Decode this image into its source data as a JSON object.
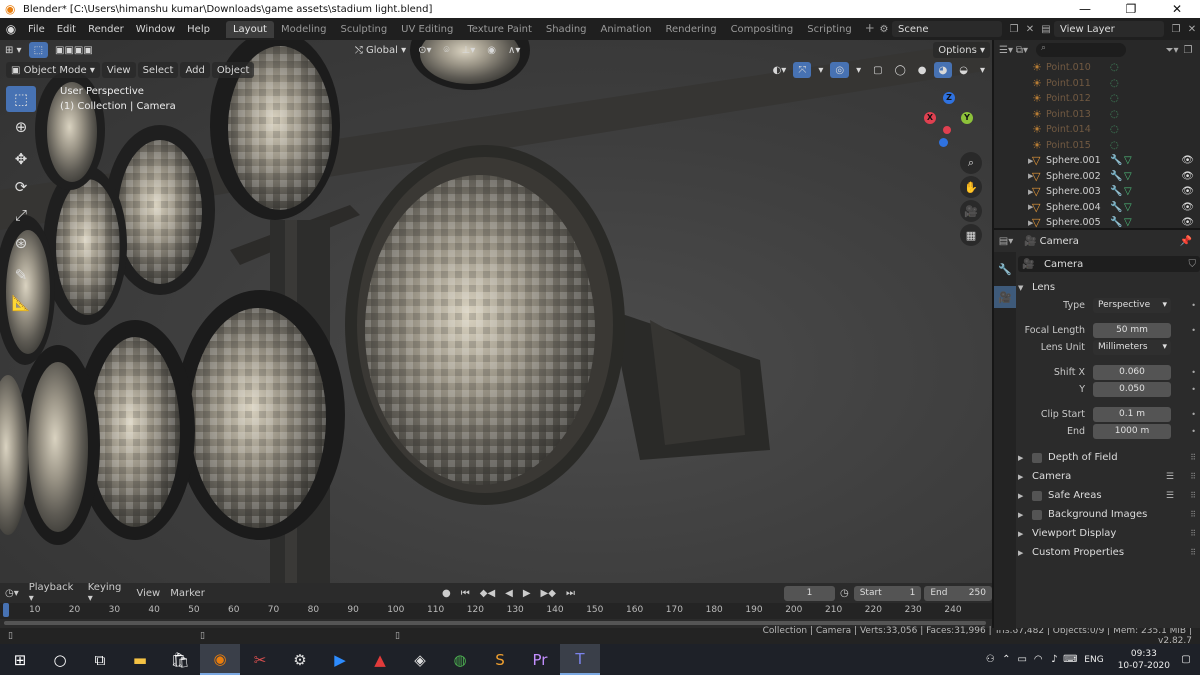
{
  "window": {
    "title": "Blender* [C:\\Users\\himanshu kumar\\Downloads\\game assets\\stadium light.blend]",
    "minimize": "—",
    "maximize": "❐",
    "close": "✕"
  },
  "menu": [
    "File",
    "Edit",
    "Render",
    "Window",
    "Help"
  ],
  "workspaces": [
    "Layout",
    "Modeling",
    "Sculpting",
    "UV Editing",
    "Texture Paint",
    "Shading",
    "Animation",
    "Rendering",
    "Compositing",
    "Scripting"
  ],
  "active_workspace": "Layout",
  "scene": "Scene",
  "view_layer": "View Layer",
  "viewport": {
    "transform_orientation": "Global",
    "options_label": "Options",
    "mode": "Object Mode",
    "header_menus": [
      "View",
      "Select",
      "Add",
      "Object"
    ],
    "overlay_line1": "User Perspective",
    "overlay_line2": "(1) Collection | Camera",
    "gizmo_axes": {
      "x": "X",
      "y": "Y",
      "z": "Z"
    },
    "tools": [
      "select-box-icon",
      "cursor-icon",
      "move-icon",
      "rotate-icon",
      "scale-icon",
      "transform-icon",
      "annotate-icon",
      "measure-icon"
    ],
    "scene_visual": "stadium flood light model with reflective lamp discs"
  },
  "timeline": {
    "menus": [
      "Playback",
      "Keying",
      "View",
      "Marker"
    ],
    "current_frame": "1",
    "start_label": "Start",
    "start": "1",
    "end_label": "End",
    "end": "250",
    "ticks": [
      "10",
      "20",
      "30",
      "40",
      "50",
      "60",
      "70",
      "80",
      "90",
      "100",
      "110",
      "120",
      "130",
      "140",
      "150",
      "160",
      "170",
      "180",
      "190",
      "200",
      "210",
      "220",
      "230",
      "240"
    ]
  },
  "status": "Collection | Camera | Verts:33,056 | Faces:31,996 | Tris:67,482 | Objects:0/9 | Mem: 235.1 MiB | v2.82.7",
  "outliner": {
    "rows": [
      {
        "name": "Point.010",
        "dim": true
      },
      {
        "name": "Point.011",
        "dim": true
      },
      {
        "name": "Point.012",
        "dim": true
      },
      {
        "name": "Point.013",
        "dim": true
      },
      {
        "name": "Point.014",
        "dim": true
      },
      {
        "name": "Point.015",
        "dim": true
      },
      {
        "name": "Sphere.001",
        "dim": false
      },
      {
        "name": "Sphere.002",
        "dim": false
      },
      {
        "name": "Sphere.003",
        "dim": false
      },
      {
        "name": "Sphere.004",
        "dim": false
      },
      {
        "name": "Sphere.005",
        "dim": false
      }
    ]
  },
  "properties": {
    "context": "Camera",
    "object_name": "Camera",
    "lens_panel": "Lens",
    "type_label": "Type",
    "type_value": "Perspective",
    "focal_label": "Focal Length",
    "focal_value": "50 mm",
    "lens_unit_label": "Lens Unit",
    "lens_unit_value": "Millimeters",
    "shift_x_label": "Shift X",
    "shift_x_value": "0.060",
    "shift_y_label": "Y",
    "shift_y_value": "0.050",
    "clip_start_label": "Clip Start",
    "clip_start_value": "0.1 m",
    "clip_end_label": "End",
    "clip_end_value": "1000 m",
    "panels": [
      "Depth of Field",
      "Camera",
      "Safe Areas",
      "Background Images",
      "Viewport Display",
      "Custom Properties"
    ]
  },
  "taskbar": {
    "language": "ENG",
    "time": "09:33",
    "date": "10-07-2020"
  },
  "colors": {
    "accent": "#4772b3",
    "blender_orange": "#e87d0d",
    "camera_green": "#5fd0a0"
  }
}
